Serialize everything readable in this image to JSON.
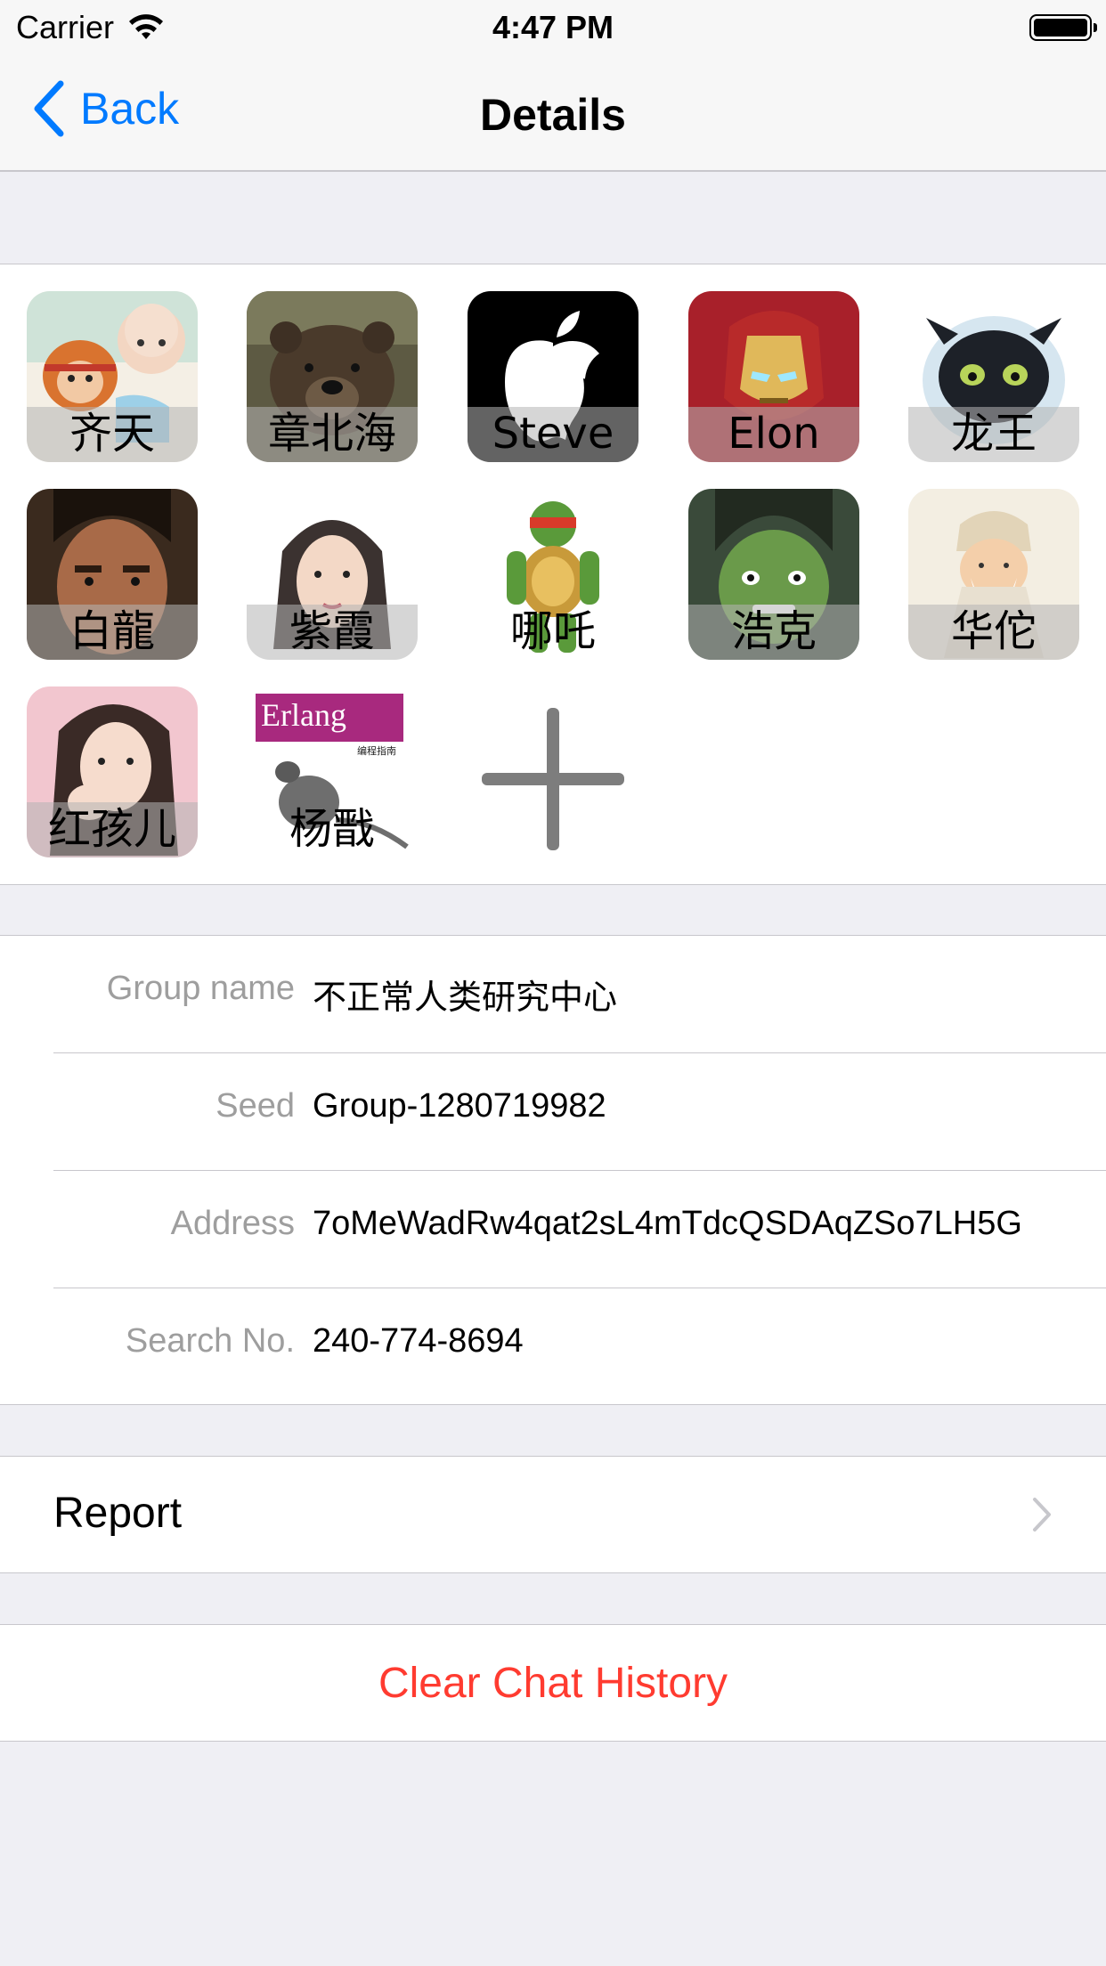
{
  "status_bar": {
    "carrier": "Carrier",
    "time": "4:47 PM"
  },
  "nav": {
    "back_label": "Back",
    "title": "Details"
  },
  "members": [
    {
      "name": "齐天",
      "avatar": "monk-and-monkey-cartoon"
    },
    {
      "name": "章北海",
      "avatar": "brown-bear"
    },
    {
      "name": "Steve",
      "avatar": "apple-logo-silhouette"
    },
    {
      "name": "Elon",
      "avatar": "iron-man-helmet"
    },
    {
      "name": "龙王",
      "avatar": "black-dragon-cartoon"
    },
    {
      "name": "白龍",
      "avatar": "man-portrait"
    },
    {
      "name": "紫霞",
      "avatar": "woman-sketch"
    },
    {
      "name": "哪吒",
      "avatar": "ninja-turtle"
    },
    {
      "name": "浩克",
      "avatar": "hulk-cartoon"
    },
    {
      "name": "华佗",
      "avatar": "old-sage-cartoon"
    },
    {
      "name": "红孩儿",
      "avatar": "woman-portrait"
    },
    {
      "name": "杨戬",
      "avatar": "erlang-book-cover"
    }
  ],
  "erlang_cover_text": "Erlang",
  "erlang_cover_subtitle": "编程指南",
  "add_member_icon": "plus-icon",
  "info": {
    "group_name_label": "Group name",
    "group_name_value": "不正常人类研究中心",
    "seed_label": "Seed",
    "seed_value": "Group-1280719982",
    "address_label": "Address",
    "address_value": "7oMeWadRw4qat2sL4mTdcQSDAqZSo7LH5G",
    "search_label": "Search No.",
    "search_value": "240-774-8694"
  },
  "report_label": "Report",
  "clear_label": "Clear Chat History",
  "colors": {
    "accent": "#007aff",
    "destructive": "#ff3b30",
    "background": "#efeff4"
  }
}
